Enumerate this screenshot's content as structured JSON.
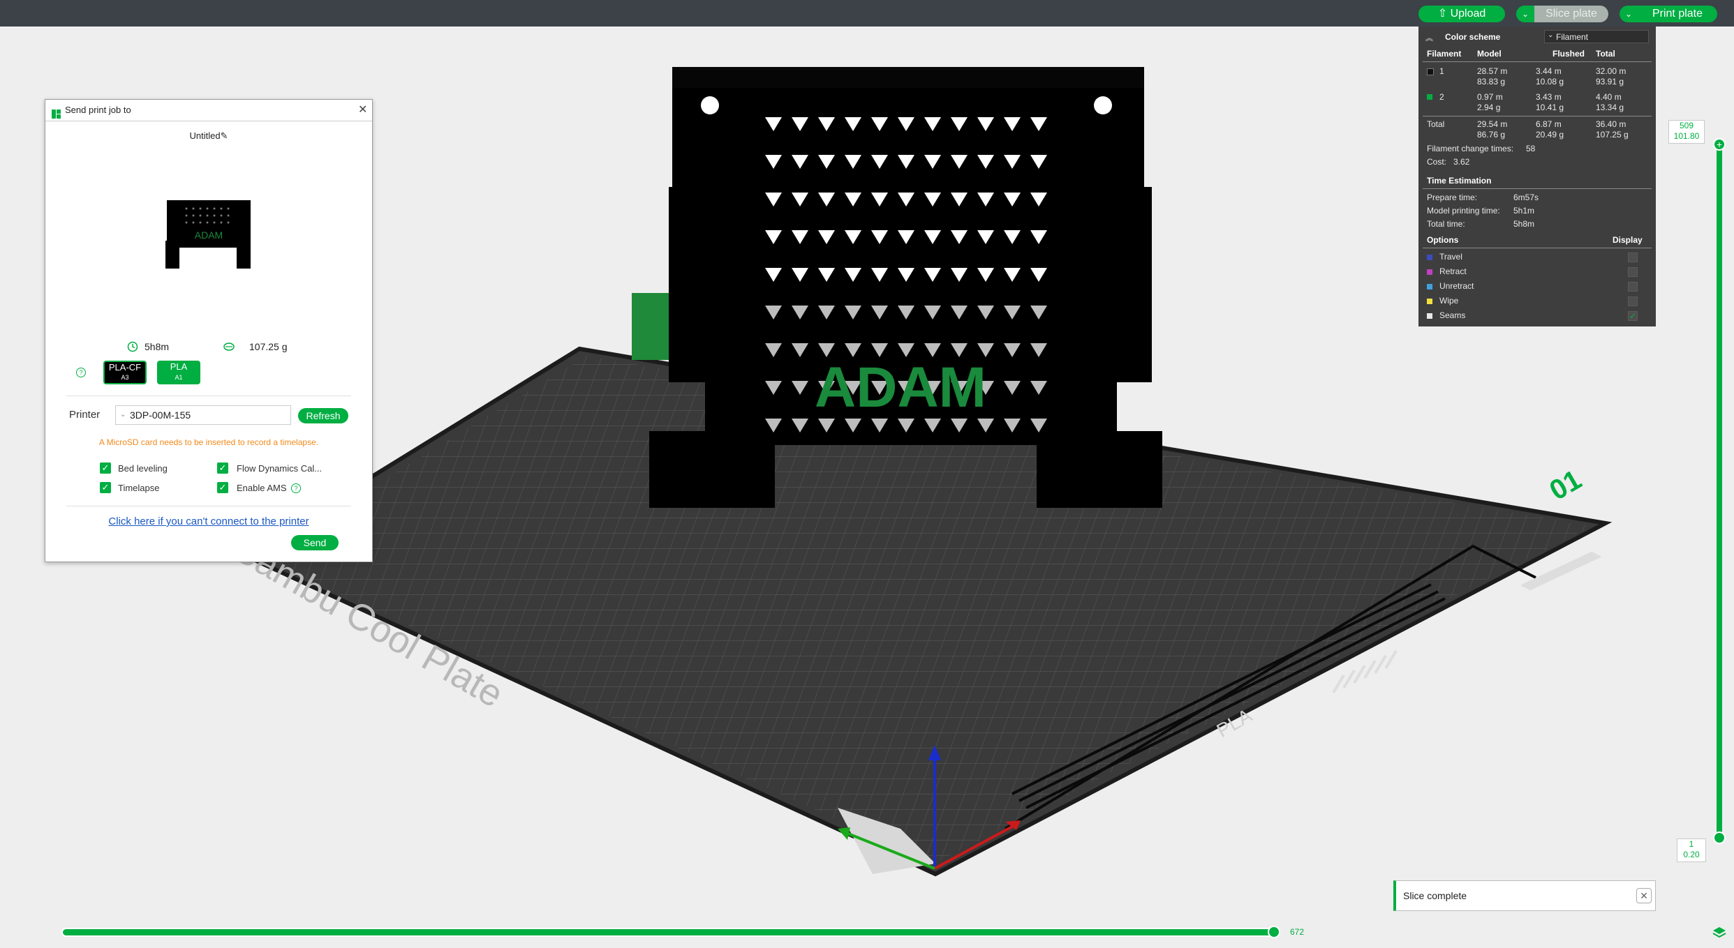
{
  "toolbar": {
    "upload_label": "Upload",
    "upload_icon": "upload-icon",
    "slice_label": "Slice plate",
    "print_label": "Print plate",
    "dropdown_glyph": "⌄"
  },
  "scene": {
    "model_text": "ADAM",
    "plate_text": "Bambu Cool Plate",
    "plate_number": "01",
    "plate_label": "PLA",
    "colors": {
      "model": "#000000",
      "accent": "#1a8a3c",
      "bed": "#3a3a3a",
      "grid": "#555555"
    }
  },
  "dialog": {
    "title": "Send print job to",
    "project_name": "Untitled",
    "preview_text": "ADAM",
    "time": "5h8m",
    "weight": "107.25 g",
    "help_glyph": "?",
    "filaments": [
      {
        "name": "PLA-CF",
        "slot": "A3",
        "color": "#000000"
      },
      {
        "name": "PLA",
        "slot": "A1",
        "color": "#00ae42"
      }
    ],
    "printer_label": "Printer",
    "printer_value": "3DP-00M-155",
    "refresh_label": "Refresh",
    "warning": "A MicroSD card needs to be inserted to record a timelapse.",
    "options": [
      {
        "label": "Bed leveling",
        "checked": true
      },
      {
        "label": "Flow Dynamics Cal...",
        "checked": true
      },
      {
        "label": "Timelapse",
        "checked": true
      },
      {
        "label": "Enable AMS",
        "checked": true
      }
    ],
    "connect_link": "Click here if you can't connect to the printer",
    "send_label": "Send",
    "close_glyph": "✕",
    "check_glyph": "✓",
    "edit_glyph": "✎"
  },
  "legend": {
    "color_scheme_label": "Color scheme",
    "scheme_value": "Filament",
    "columns": [
      "Filament",
      "Model",
      "Flushed",
      "Total"
    ],
    "rows": [
      {
        "id": "1",
        "color": "#111111",
        "model": [
          "28.57 m",
          "83.83 g"
        ],
        "flushed": [
          "3.44 m",
          "10.08 g"
        ],
        "total": [
          "32.00 m",
          "93.91 g"
        ]
      },
      {
        "id": "2",
        "color": "#00ae42",
        "model": [
          "0.97 m",
          "2.94 g"
        ],
        "flushed": [
          "3.43 m",
          "10.41 g"
        ],
        "total": [
          "4.40 m",
          "13.34 g"
        ]
      }
    ],
    "total_row": {
      "label": "Total",
      "model": [
        "29.54 m",
        "86.76 g"
      ],
      "flushed": [
        "6.87 m",
        "20.49 g"
      ],
      "total": [
        "36.40 m",
        "107.25 g"
      ]
    },
    "change_times_label": "Filament change times:",
    "change_times": "58",
    "cost_label": "Cost:",
    "cost": "3.62",
    "time_header": "Time Estimation",
    "times": [
      {
        "label": "Prepare time:",
        "value": "6m57s"
      },
      {
        "label": "Model printing time:",
        "value": "5h1m"
      },
      {
        "label": "Total time:",
        "value": "5h8m"
      }
    ],
    "options_header": "Options",
    "display_header": "Display",
    "options": [
      {
        "label": "Travel",
        "color": "#3b4cc0",
        "checked": false
      },
      {
        "label": "Retract",
        "color": "#c040c0",
        "checked": false
      },
      {
        "label": "Unretract",
        "color": "#40a0e0",
        "checked": false
      },
      {
        "label": "Wipe",
        "color": "#f0e040",
        "checked": false
      },
      {
        "label": "Seams",
        "color": "#e8e8e8",
        "checked": true
      }
    ]
  },
  "layers": {
    "top_layer": "509",
    "top_height": "101.80",
    "bottom_layer": "1",
    "bottom_height": "0.20",
    "move_value": "672"
  },
  "notification": {
    "text": "Slice complete"
  }
}
